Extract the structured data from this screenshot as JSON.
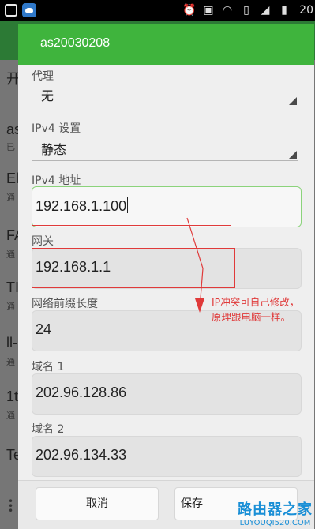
{
  "status_bar": {
    "time": "20",
    "icons": [
      "alarm-icon",
      "notification-icon",
      "wifi-icon",
      "sim-icon",
      "signal-icon",
      "battery-icon"
    ]
  },
  "background_app": {
    "title_initial": "开",
    "items": [
      {
        "title": "as",
        "sub": "已"
      },
      {
        "title": "El",
        "sub": "通"
      },
      {
        "title": "FA",
        "sub": "通"
      },
      {
        "title": "TI",
        "sub": "通"
      },
      {
        "title": "ll-",
        "sub": "通"
      },
      {
        "title": "1t",
        "sub": "通"
      },
      {
        "title": "Te",
        "sub": ""
      }
    ]
  },
  "dialog": {
    "title": "as20030208",
    "proxy": {
      "label": "代理",
      "value": "无"
    },
    "ipv4_settings": {
      "label": "IPv4 设置",
      "value": "静态"
    },
    "ipv4_address": {
      "label": "IPv4 地址",
      "value": "192.168.1.100"
    },
    "gateway": {
      "label": "网关",
      "value": "192.168.1.1"
    },
    "prefix_length": {
      "label": "网络前缀长度",
      "value": "24"
    },
    "dns1": {
      "label": "域名 1",
      "value": "202.96.128.86"
    },
    "dns2": {
      "label": "域名 2",
      "value": "202.96.134.33"
    },
    "cancel_label": "取消",
    "save_label": "保存"
  },
  "annotation": {
    "line1": "IP冲突可自己修改，",
    "line2": "原理跟电脑一样。",
    "color": "#e03a3a"
  },
  "watermark": {
    "line1": "路由器之家",
    "line2": "LUYOUQI520.COM"
  },
  "colors": {
    "accent": "#3fb43d",
    "status_bar": "#000000"
  }
}
